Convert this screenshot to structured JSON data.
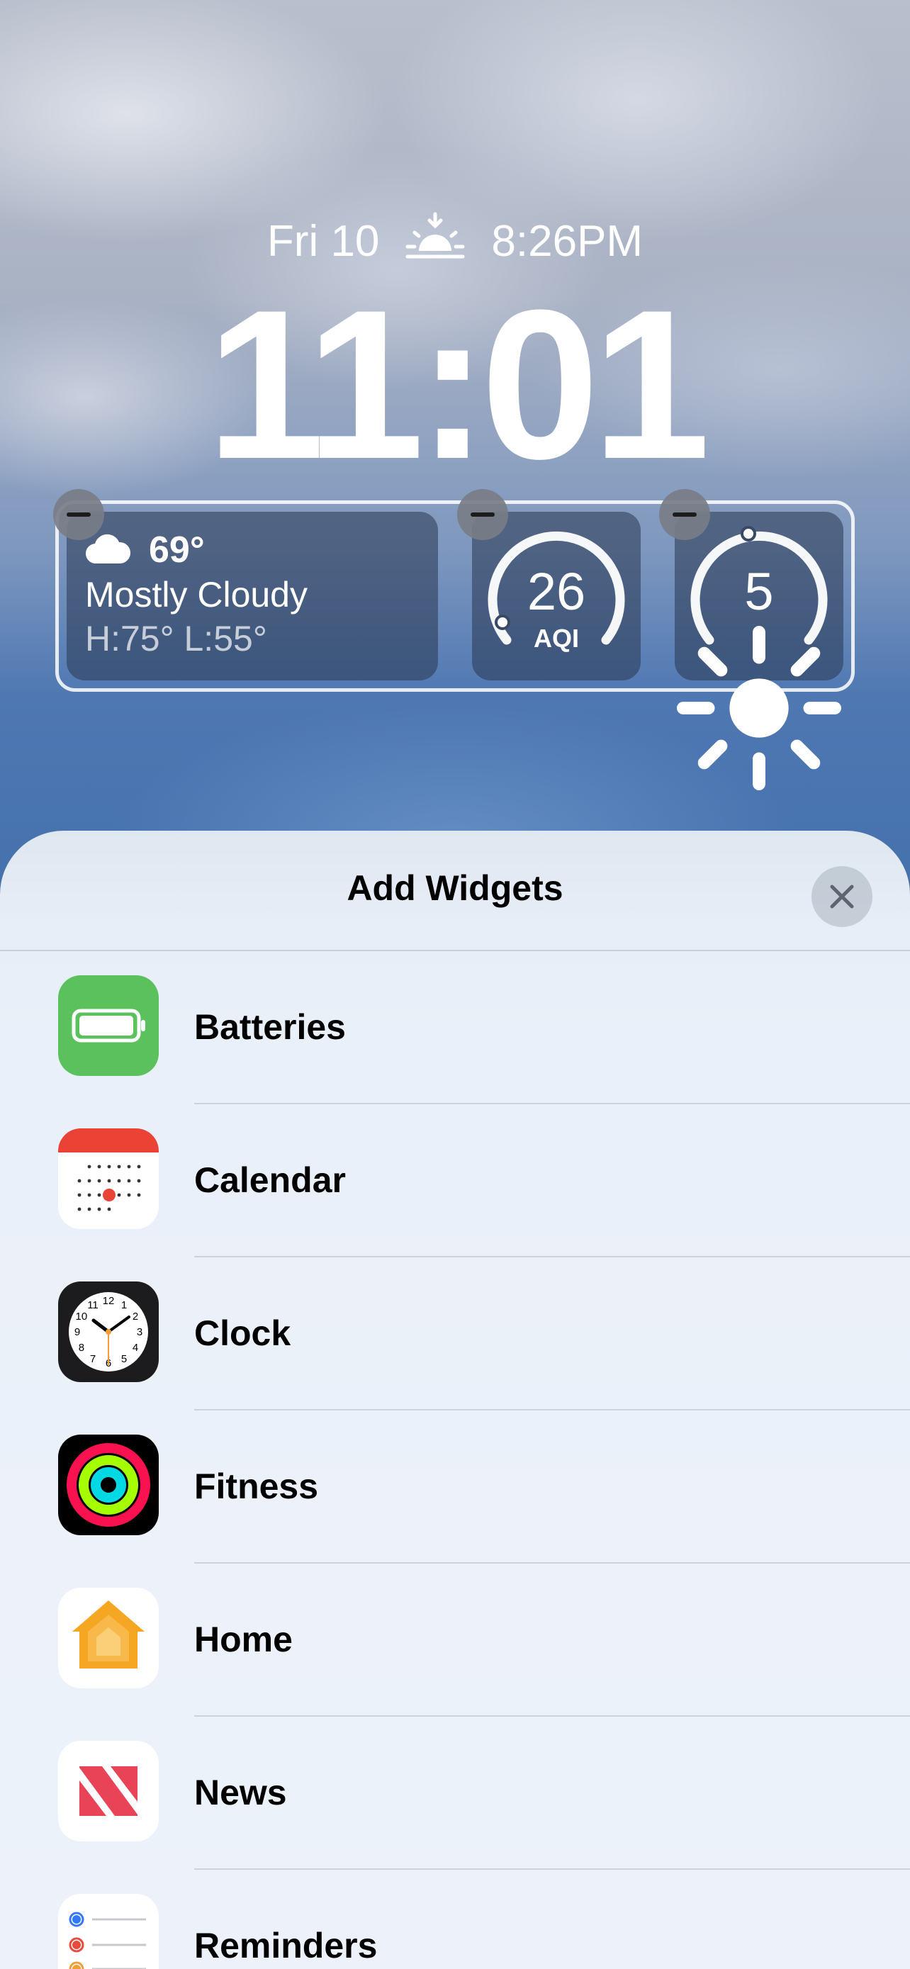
{
  "lockscreen": {
    "date": "Fri 10",
    "sunset_icon": "sunset-icon",
    "sunset_time": "8:26PM",
    "time": "11:01"
  },
  "widgets": {
    "weather": {
      "icon": "cloud-icon",
      "temperature": "69°",
      "condition": "Mostly Cloudy",
      "high_low": "H:75° L:55°"
    },
    "aqi": {
      "value": "26",
      "label": "AQI",
      "level": 0.55
    },
    "uv": {
      "value": "5",
      "icon": "sun-icon",
      "level": 0.5
    }
  },
  "sheet": {
    "title": "Add Widgets",
    "close_icon": "close-icon",
    "apps": [
      {
        "label": "Batteries",
        "icon": "batteries-app-icon"
      },
      {
        "label": "Calendar",
        "icon": "calendar-app-icon"
      },
      {
        "label": "Clock",
        "icon": "clock-app-icon"
      },
      {
        "label": "Fitness",
        "icon": "fitness-app-icon"
      },
      {
        "label": "Home",
        "icon": "home-app-icon"
      },
      {
        "label": "News",
        "icon": "news-app-icon"
      },
      {
        "label": "Reminders",
        "icon": "reminders-app-icon"
      }
    ],
    "clock_numbers": [
      "12",
      "1",
      "2",
      "3",
      "4",
      "5",
      "6",
      "7",
      "8",
      "9",
      "10",
      "11"
    ]
  },
  "colors": {
    "batteries_green": "#5ac15c",
    "calendar_red": "#ea4335",
    "fitness_move": "#fa114f",
    "fitness_exercise": "#a6ff00",
    "fitness_stand": "#00d9e4",
    "home_orange": "#f5a623",
    "news_red": "#e84357"
  }
}
